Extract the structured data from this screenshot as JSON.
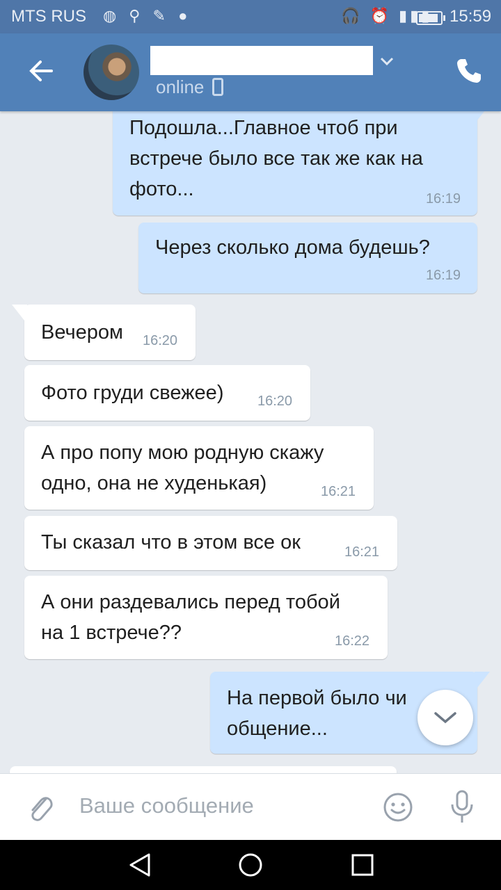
{
  "status_bar": {
    "carrier": "MTS RUS",
    "time": "15:59"
  },
  "header": {
    "presence": "online"
  },
  "messages": [
    {
      "dir": "out",
      "text": "Подошла...Главное чтоб при встрече было все так же как на фото...",
      "time": "16:19"
    },
    {
      "dir": "out",
      "text": "Через сколько дома будешь?",
      "time": "16:19"
    },
    {
      "dir": "in",
      "text": "Вечером",
      "time": "16:20"
    },
    {
      "dir": "in",
      "text": "Фото груди свежее)",
      "time": "16:20"
    },
    {
      "dir": "in",
      "text": "А про попу мою родную скажу одно, она не худенькая)",
      "time": "16:21"
    },
    {
      "dir": "in",
      "text": "Ты сказал что в этом все ок",
      "time": "16:21"
    },
    {
      "dir": "in",
      "text": "А они раздевались перед тобой на 1 встрече??",
      "time": "16:22"
    },
    {
      "dir": "out",
      "text": "На первой было чи... общение...",
      "time": ""
    }
  ],
  "message_lines": {
    "m0": [
      "Подошла...Главное чтоб при",
      "встрече было все так же как на",
      "фото..."
    ],
    "m4": [
      "А про попу мою родную скажу",
      "одно, она не худенькая)"
    ],
    "m6": [
      "А они раздевались перед тобой",
      "на 1 встрече??"
    ],
    "m7": [
      "На первой было чи",
      "общение..."
    ]
  },
  "input": {
    "placeholder": "Ваше сообщение"
  },
  "colors": {
    "header": "#5181b8",
    "status_bar": "#4f76a8",
    "chat_bg": "#e7ebf0",
    "out_bubble": "#cce4ff",
    "in_bubble": "#ffffff"
  },
  "icons": [
    "back-arrow-icon",
    "chevron-down-icon",
    "phone-icon",
    "mobile-icon",
    "paperclip-icon",
    "smile-icon",
    "microphone-icon",
    "nav-back-icon",
    "nav-home-icon",
    "nav-recent-icon",
    "scroll-down-icon"
  ]
}
